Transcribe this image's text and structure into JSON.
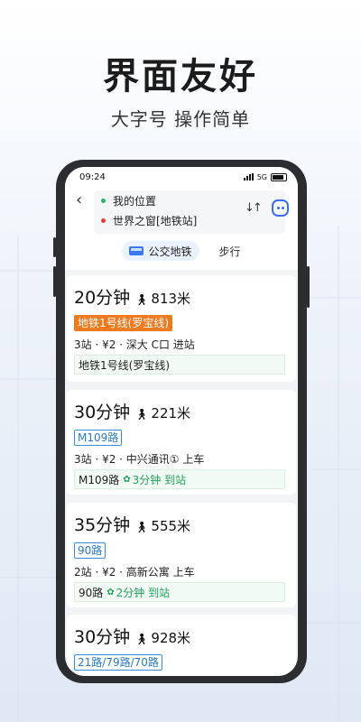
{
  "promo": {
    "headline": "界面友好",
    "subline": "大字号 操作简单"
  },
  "statusbar": {
    "time": "09:24",
    "network": "5G"
  },
  "route": {
    "origin": "我的位置",
    "destination": "世界之窗[地铁站]",
    "modes": [
      {
        "label": "公交地铁",
        "active": true
      },
      {
        "label": "步行",
        "active": false
      }
    ]
  },
  "results": [
    {
      "duration": "20分钟",
      "walk": "813米",
      "tag": "地铁1号线(罗宝线)",
      "info": "3站 · ¥2 · 深大 C口 进站",
      "realtime_line": "地铁1号线(罗宝线)",
      "realtime_eta": ""
    },
    {
      "duration": "30分钟",
      "walk": "221米",
      "tag": "M109路",
      "info": "3站 · ¥2 · 中兴通讯① 上车",
      "realtime_line": "M109路",
      "realtime_eta": "3分钟 到站"
    },
    {
      "duration": "35分钟",
      "walk": "555米",
      "tag": "90路",
      "info": "2站 · ¥2 · 高新公寓 上车",
      "realtime_line": "90路",
      "realtime_eta": "2分钟 到站"
    },
    {
      "duration": "30分钟",
      "walk": "928米",
      "tag": "21路/79路/70路",
      "info": "",
      "realtime_line": "",
      "realtime_eta": ""
    }
  ],
  "colors": {
    "subway_tag": "#f07a1f",
    "bus_tag": "#3a8fe0",
    "realtime_green": "#20a35a",
    "accent_blue": "#3c6cf0"
  }
}
